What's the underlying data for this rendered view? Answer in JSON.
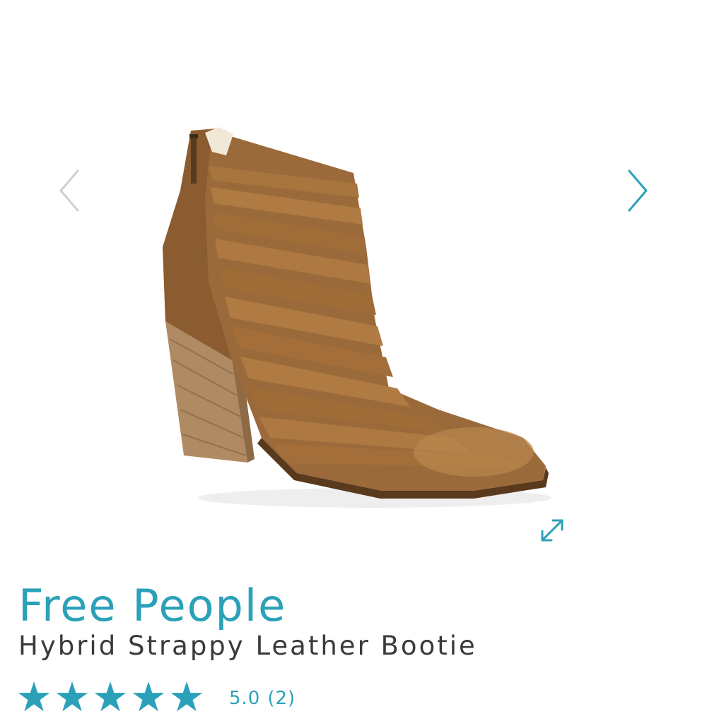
{
  "gallery": {
    "prev_icon": "chevron-left-icon",
    "next_icon": "chevron-right-icon",
    "expand_icon": "expand-icon",
    "arrow_color_inactive": "#d0d0d0",
    "arrow_color_active": "#2aa1b8"
  },
  "product": {
    "brand": "Free People",
    "name": "Hybrid Strappy Leather Bootie",
    "rating": {
      "score_text": "5.0",
      "count_text": "(2)",
      "stars_filled": 5,
      "stars_total": 5,
      "star_glyph": "★"
    }
  },
  "colors": {
    "accent": "#2aa1b8",
    "text": "#3a3a3a",
    "leather": "#9b6a3a",
    "heel_wood": "#b08a62"
  }
}
